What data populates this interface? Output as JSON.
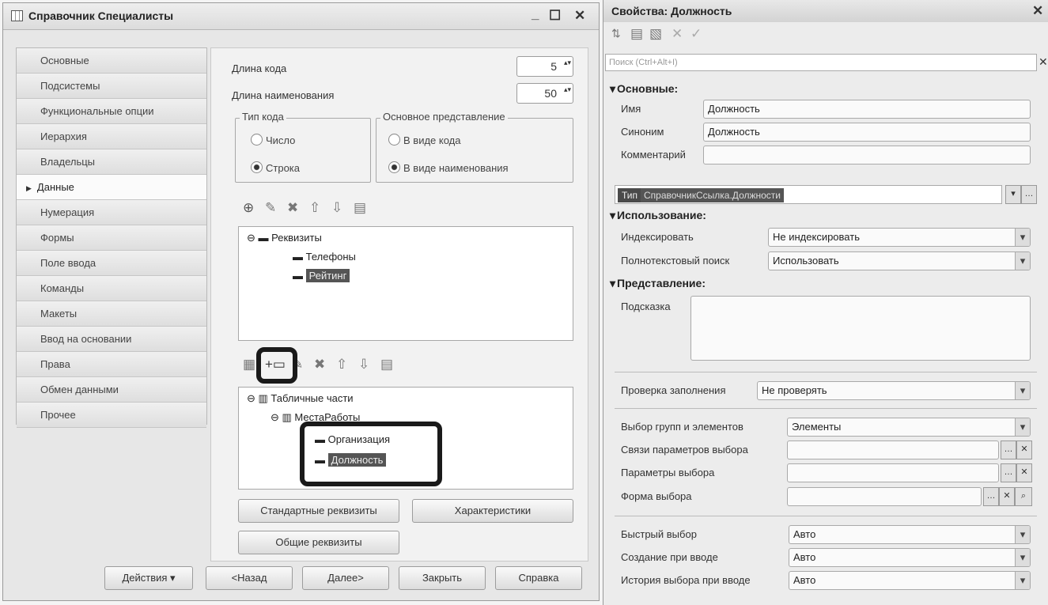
{
  "left_window": {
    "title": "Справочник Специалисты",
    "controls": {
      "minimize": "_",
      "maximize": "☐",
      "close": "✕"
    },
    "tabs": [
      {
        "label": "Основные"
      },
      {
        "label": "Подсистемы"
      },
      {
        "label": "Функциональные опции"
      },
      {
        "label": "Иерархия"
      },
      {
        "label": "Владельцы"
      },
      {
        "label": "Данные",
        "active": true
      },
      {
        "label": "Нумерация"
      },
      {
        "label": "Формы"
      },
      {
        "label": "Поле ввода"
      },
      {
        "label": "Команды"
      },
      {
        "label": "Макеты"
      },
      {
        "label": "Ввод на основании"
      },
      {
        "label": "Права"
      },
      {
        "label": "Обмен данными"
      },
      {
        "label": "Прочее"
      }
    ],
    "code_length": {
      "label": "Длина кода",
      "value": "5"
    },
    "name_length": {
      "label": "Длина наименования",
      "value": "50"
    },
    "code_type": {
      "title": "Тип кода",
      "options": [
        "Число",
        "Строка"
      ],
      "selected": "Строка"
    },
    "main_presentation": {
      "title": "Основное представление",
      "options": [
        "В виде кода",
        "В виде наименования"
      ],
      "selected": "В виде наименования"
    },
    "attributes_tree": {
      "root": "Реквизиты",
      "items": [
        "Телефоны",
        "Рейтинг"
      ],
      "selected": "Рейтинг"
    },
    "tabular_tree": {
      "root": "Табличные части",
      "child": "МестаРаботы",
      "items": [
        "Организация",
        "Должность"
      ],
      "selected": "Должность"
    },
    "buttons": {
      "standard_attrs": "Стандартные реквизиты",
      "characteristics": "Характеристики",
      "common_attrs": "Общие реквизиты",
      "actions": "Действия",
      "back": "<Назад",
      "next": "Далее>",
      "close": "Закрыть",
      "help": "Справка"
    }
  },
  "right_window": {
    "title": "Свойства: Должность",
    "close": "✕",
    "search_placeholder": "Поиск (Ctrl+Alt+I)",
    "sections": {
      "main": "Основные:",
      "usage": "Использование:",
      "presentation": "Представление:"
    },
    "props": {
      "name": {
        "label": "Имя",
        "value": "Должность"
      },
      "synonym": {
        "label": "Синоним",
        "value": "Должность"
      },
      "comment": {
        "label": "Комментарий",
        "value": ""
      },
      "type": {
        "label": "Тип",
        "value": "СправочникСсылка.Должности"
      },
      "index": {
        "label": "Индексировать",
        "value": "Не индексировать"
      },
      "fulltext": {
        "label": "Полнотекстовый поиск",
        "value": "Использовать"
      },
      "tooltip": {
        "label": "Подсказка",
        "value": ""
      },
      "fill_check": {
        "label": "Проверка заполнения",
        "value": "Не проверять"
      },
      "group_select": {
        "label": "Выбор групп и элементов",
        "value": "Элементы"
      },
      "choice_links": {
        "label": "Связи параметров выбора",
        "value": ""
      },
      "choice_params": {
        "label": "Параметры выбора",
        "value": ""
      },
      "choice_form": {
        "label": "Форма выбора",
        "value": ""
      },
      "quick_choice": {
        "label": "Быстрый выбор",
        "value": "Авто"
      },
      "create_on_input": {
        "label": "Создание при вводе",
        "value": "Авто"
      },
      "history": {
        "label": "История выбора при вводе",
        "value": "Авто"
      }
    }
  }
}
